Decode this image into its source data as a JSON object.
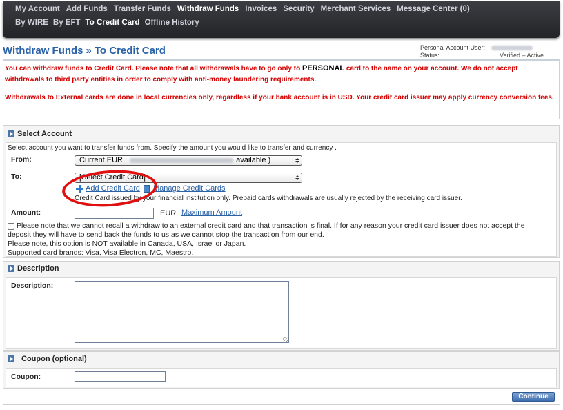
{
  "nav": {
    "primary": [
      {
        "label": "My Account",
        "active": false
      },
      {
        "label": "Add Funds",
        "active": false
      },
      {
        "label": "Transfer Funds",
        "active": false
      },
      {
        "label": "Withdraw Funds",
        "active": true
      },
      {
        "label": "Invoices",
        "active": false
      },
      {
        "label": "Security",
        "active": false
      },
      {
        "label": "Merchant Services",
        "active": false
      },
      {
        "label": "Message Center (0)",
        "active": false
      }
    ],
    "secondary": [
      {
        "label": "By WIRE",
        "active": false
      },
      {
        "label": "By EFT",
        "active": false
      },
      {
        "label": "To Credit Card",
        "active": true
      },
      {
        "label": "Offline History",
        "active": false
      }
    ]
  },
  "header": {
    "breadcrumb_parent": "Withdraw Funds",
    "separator": "»",
    "title": "To Credit Card",
    "account_label": "Personal Account User:",
    "status_label": "Status:",
    "status_value": "Verified – Active"
  },
  "warning": {
    "line1_before": "You can withdraw funds to Credit Card. Please note that all withdrawals have to go only to ",
    "line1_strong": "PERSONAL",
    "line1_after": " card to the name on your account. We do not accept withdrawals to third party entities in order to comply with anti-money laundering requirements.",
    "line2": "Withdrawals to External cards are done in local currencies only, regardless if your bank account is in USD. Your credit card issuer may apply currency conversion fees."
  },
  "select_account": {
    "title": "Select Account",
    "intro": "Select account you want to transfer funds from. Specify the amount you would like to transfer and currency .",
    "from_label": "From:",
    "from_prefix": "Current EUR :",
    "from_suffix": "available )",
    "to_label": "To:",
    "to_value": "[Select Credit Card]",
    "add_card_link": "Add Credit Card",
    "manage_cards_link": "Manage Credit Cards",
    "issued_note": "Credit Card issued by your financial institution only. Prepaid cards withdrawals are usually rejected by the receiving card issuer.",
    "amount_label": "Amount:",
    "amount_value": "",
    "currency": "EUR",
    "max_amount_link": "Maximum Amount",
    "disclaimer_1": "Please note that we cannot recall a withdraw to an external credit card and that transaction is final. If for any reason your credit card issuer does not accept the",
    "disclaimer_2": "deposit they will have to send back the funds to us as we cannot stop the transaction from our end.",
    "disclaimer_3": "Please note, this option is NOT available in Canada, USA, Israel or Japan.",
    "disclaimer_4": "Supported card brands: Visa, Visa Electron, MC, Maestro."
  },
  "description": {
    "title": "Description",
    "label": "Description:",
    "value": ""
  },
  "coupon": {
    "title": "Coupon (optional)",
    "label": "Coupon:",
    "value": ""
  },
  "actions": {
    "continue_label": "Continue"
  },
  "colors": {
    "nav_bg": "#2a2c31",
    "link_blue": "#2a62a8",
    "warning_red": "#d40000",
    "annotation_circle": "#e01010",
    "button_blue": "#3f6eaf"
  }
}
